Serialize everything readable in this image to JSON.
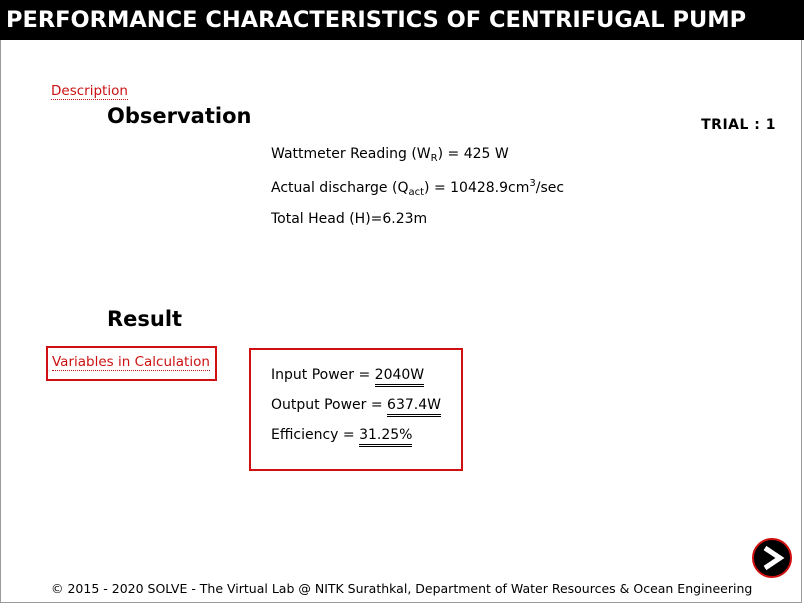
{
  "header": {
    "title": "PERFORMANCE CHARACTERISTICS OF CENTRIFUGAL PUMP"
  },
  "nav": {
    "description_link": "Description",
    "variables_link": "Variables in Calculation"
  },
  "observation": {
    "heading": "Observation",
    "trial": "TRIAL : 1",
    "wattmeter_label": "Wattmeter Reading (W",
    "wattmeter_sub": "R",
    "wattmeter_rest": ") = 425 W",
    "discharge_label": "Actual discharge (Q",
    "discharge_sub": "act",
    "discharge_rest": ") = 10428.9cm",
    "discharge_sup": "3",
    "discharge_unit": "/sec",
    "head": "Total Head (H)=6.23m"
  },
  "result": {
    "heading": "Result",
    "input_power_label": "Input Power = ",
    "input_power_value": "2040W",
    "output_power_label": "Output Power = ",
    "output_power_value": "637.4W",
    "efficiency_label": "Efficiency = ",
    "efficiency_value": "31.25%"
  },
  "footer": {
    "text": "© 2015 - 2020 SOLVE - The Virtual Lab @ NITK Surathkal, Department of Water Resources & Ocean Engineering"
  },
  "icons": {
    "next": "next-arrow-icon"
  },
  "colors": {
    "title_bg": "#000000",
    "title_text": "#ffffff",
    "accent_red": "#d01010",
    "link_red": "#cc1111"
  }
}
